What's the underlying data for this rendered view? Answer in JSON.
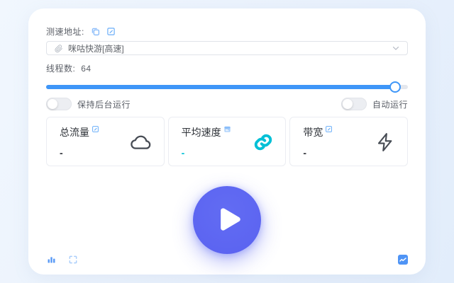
{
  "address": {
    "label": "测速地址:",
    "selected_value": "咪咕快游[高速]"
  },
  "threads": {
    "label": "线程数:",
    "value": "64",
    "fill_style": "width:96.5%"
  },
  "toggles": {
    "keep_background": {
      "label": "保持后台运行",
      "state": "off"
    },
    "auto_run": {
      "label": "自动运行",
      "state": "off"
    }
  },
  "stats": [
    {
      "label": "总流量",
      "value": "-",
      "header_icon": "edit-icon",
      "big_icon": "cloud-icon"
    },
    {
      "label": "平均速度",
      "value": "-",
      "header_icon": "calendar-icon",
      "big_icon": "link-icon"
    },
    {
      "label": "带宽",
      "value": "-",
      "header_icon": "edit-icon",
      "big_icon": "lightning-icon"
    }
  ],
  "colors": {
    "accent_blue": "#3e96f8",
    "cyan": "#00c0d6",
    "play_button": "#5a62f0",
    "background": "#eaf2fc",
    "card": "#ffffff"
  }
}
